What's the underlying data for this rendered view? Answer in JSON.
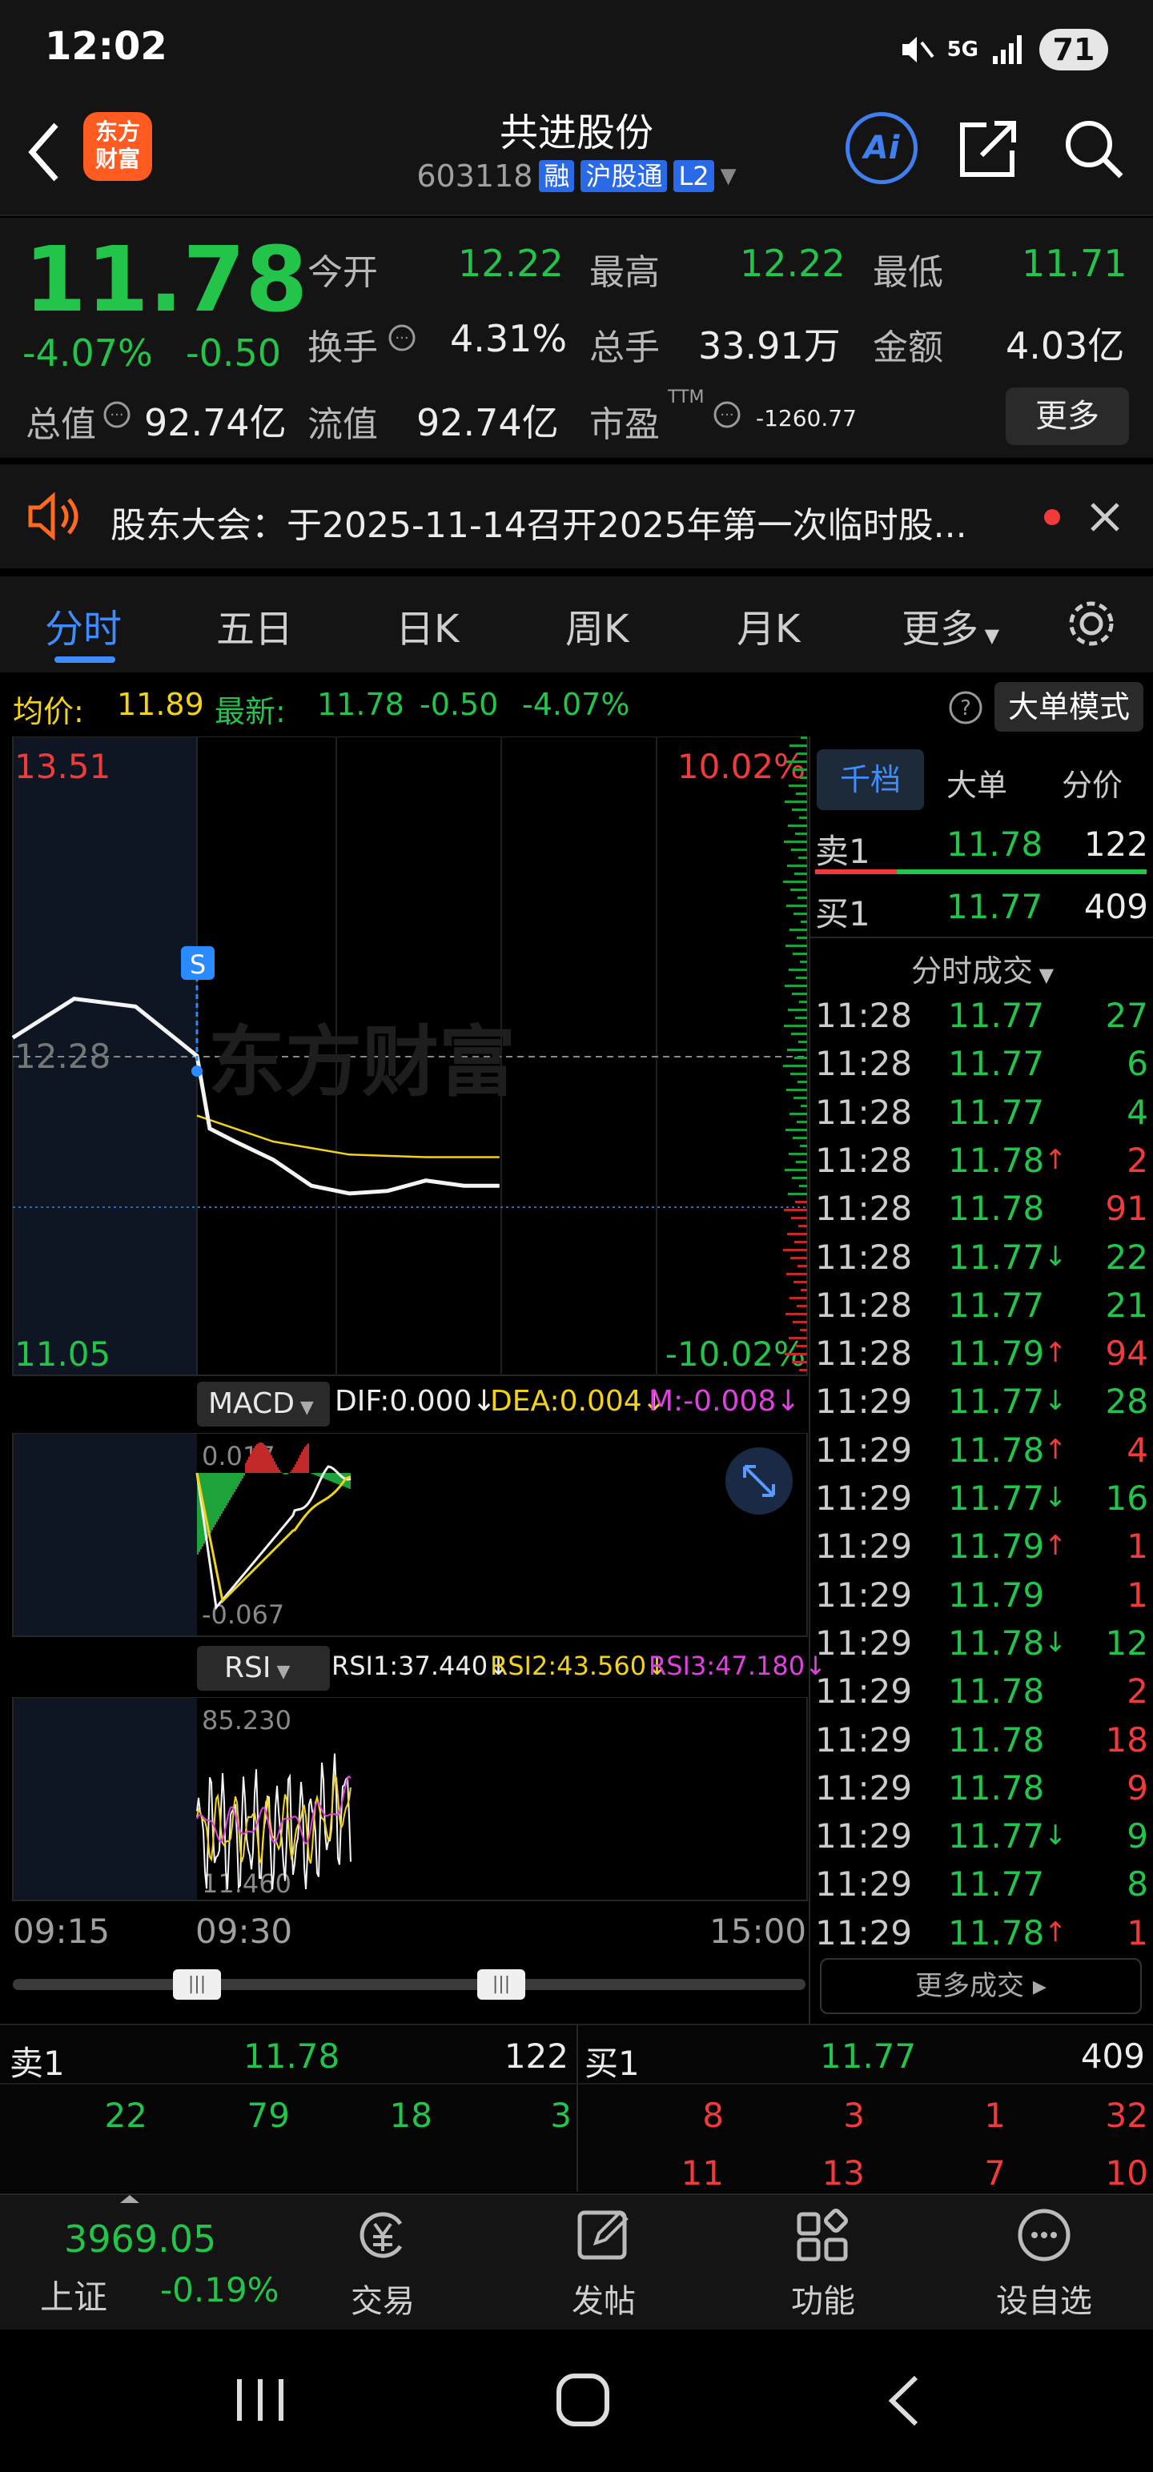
{
  "status": {
    "time": "12:02",
    "network": "5G",
    "battery": "71"
  },
  "header": {
    "title": "共进股份",
    "code": "603118",
    "tags": [
      "融",
      "沪股通",
      "L2"
    ],
    "logo_line1": "东方",
    "logo_line2": "财富",
    "ai_label": "Ai"
  },
  "quote": {
    "price": "11.78",
    "change_pct": "-4.07%",
    "change": "-0.50",
    "open_label": "今开",
    "open": "12.22",
    "high_label": "最高",
    "high": "12.22",
    "low_label": "最低",
    "low": "11.71",
    "turnover_label": "换手",
    "turnover": "4.31%",
    "volume_label": "总手",
    "volume": "33.91万",
    "amount_label": "金额",
    "amount": "4.03亿",
    "mcap_label": "总值",
    "mcap": "92.74亿",
    "float_label": "流值",
    "float": "92.74亿",
    "pe_label": "市盈",
    "pe_sup": "TTM",
    "pe": "-1260.77",
    "more_button": "更多"
  },
  "notice": {
    "text": "股东大会：于2025-11-14召开2025年第一次临时股..."
  },
  "tabs": [
    "分时",
    "五日",
    "日K",
    "周K",
    "月K",
    "更多"
  ],
  "chart_info": {
    "avg_label": "均价:",
    "avg": "11.89",
    "latest_label": "最新:",
    "latest": "11.78",
    "chg": "-0.50",
    "pct": "-4.07%",
    "mode_button": "大单模式"
  },
  "chart_labels": {
    "ytop": "13.51",
    "ymid": "12.28",
    "ybot": "11.05",
    "pct_top": "10.02%",
    "pct_bot": "-10.02%",
    "watermark": "东方财富",
    "signal": "S",
    "t_start": "09:15",
    "t_open": "09:30",
    "t_end": "15:00"
  },
  "macd": {
    "name": "MACD",
    "dif": "DIF:0.000",
    "dea": "DEA:0.004",
    "m": "M:-0.008",
    "top": "0.017",
    "bot": "-0.067"
  },
  "rsi": {
    "name": "RSI",
    "rsi1": "RSI1:37.440",
    "rsi2": "RSI2:43.560",
    "rsi3": "RSI3:47.180",
    "top": "85.230",
    "bot": "11.460"
  },
  "chart_data": {
    "type": "line",
    "title": "",
    "xlabel": "",
    "ylabel": "",
    "ylim": [
      11.05,
      13.51
    ],
    "x_ticks": [
      "09:15",
      "09:30",
      "15:00"
    ],
    "prev_close": 12.28,
    "series": [
      {
        "values_x": [
          "09:15",
          "09:20",
          "09:25",
          "09:30",
          "09:35",
          "09:45",
          "10:00",
          "10:15",
          "10:30",
          "10:45",
          "11:00",
          "11:15",
          "11:29"
        ],
        "values": [
          12.35,
          12.5,
          12.47,
          12.28,
          12.0,
          11.95,
          11.88,
          11.78,
          11.75,
          11.76,
          11.8,
          11.78,
          11.78
        ]
      },
      {
        "values_x": [
          "09:30",
          "09:45",
          "10:00",
          "10:30",
          "11:00",
          "11:29"
        ],
        "values": [
          12.05,
          12.0,
          11.95,
          11.9,
          11.89,
          11.89
        ]
      }
    ]
  },
  "side_tabs": [
    "千档",
    "大单",
    "分价"
  ],
  "side_quote": {
    "sell_label": "卖1",
    "sell_price": "11.78",
    "sell_vol": "122",
    "buy_label": "买1",
    "buy_price": "11.77",
    "buy_vol": "409"
  },
  "ticks_header": "分时成交",
  "ticks": [
    {
      "t": "11:28",
      "p": "11.77",
      "v": "27",
      "dir": "",
      "c": "green"
    },
    {
      "t": "11:28",
      "p": "11.77",
      "v": "6",
      "dir": "",
      "c": "green"
    },
    {
      "t": "11:28",
      "p": "11.77",
      "v": "4",
      "dir": "",
      "c": "green"
    },
    {
      "t": "11:28",
      "p": "11.78",
      "v": "2",
      "dir": "↑",
      "c": "red"
    },
    {
      "t": "11:28",
      "p": "11.78",
      "v": "91",
      "dir": "",
      "c": "red"
    },
    {
      "t": "11:28",
      "p": "11.77",
      "v": "22",
      "dir": "↓",
      "c": "green"
    },
    {
      "t": "11:28",
      "p": "11.77",
      "v": "21",
      "dir": "",
      "c": "green"
    },
    {
      "t": "11:28",
      "p": "11.79",
      "v": "94",
      "dir": "↑",
      "c": "red"
    },
    {
      "t": "11:29",
      "p": "11.77",
      "v": "28",
      "dir": "↓",
      "c": "green"
    },
    {
      "t": "11:29",
      "p": "11.78",
      "v": "4",
      "dir": "↑",
      "c": "red"
    },
    {
      "t": "11:29",
      "p": "11.77",
      "v": "16",
      "dir": "↓",
      "c": "green"
    },
    {
      "t": "11:29",
      "p": "11.79",
      "v": "1",
      "dir": "↑",
      "c": "red"
    },
    {
      "t": "11:29",
      "p": "11.79",
      "v": "1",
      "dir": "",
      "c": "red"
    },
    {
      "t": "11:29",
      "p": "11.78",
      "v": "12",
      "dir": "↓",
      "c": "green"
    },
    {
      "t": "11:29",
      "p": "11.78",
      "v": "2",
      "dir": "",
      "c": "red"
    },
    {
      "t": "11:29",
      "p": "11.78",
      "v": "18",
      "dir": "",
      "c": "red"
    },
    {
      "t": "11:29",
      "p": "11.78",
      "v": "9",
      "dir": "",
      "c": "red"
    },
    {
      "t": "11:29",
      "p": "11.77",
      "v": "9",
      "dir": "↓",
      "c": "green"
    },
    {
      "t": "11:29",
      "p": "11.77",
      "v": "8",
      "dir": "",
      "c": "green"
    },
    {
      "t": "11:29",
      "p": "11.78",
      "v": "1",
      "dir": "↑",
      "c": "red"
    }
  ],
  "more_ticks_button": "更多成交",
  "bottom_book": {
    "sell_label": "卖1",
    "sell_price": "11.78",
    "sell_vol": "122",
    "buy_label": "买1",
    "buy_price": "11.77",
    "buy_vol": "409",
    "sell_row1": [
      "22",
      "79",
      "18",
      "3"
    ],
    "buy_row1": [
      "8",
      "3",
      "1",
      "32"
    ],
    "buy_row2": [
      "11",
      "13",
      "7",
      "10"
    ]
  },
  "footer": {
    "index_value": "3969.05",
    "index_name": "上证",
    "index_pct": "-0.19%",
    "items": [
      "交易",
      "发帖",
      "功能",
      "设自选"
    ]
  }
}
